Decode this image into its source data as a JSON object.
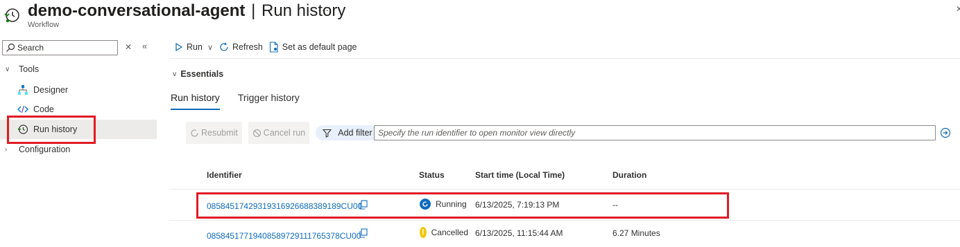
{
  "header": {
    "resource_name": "demo-conversational-agent",
    "separator": "|",
    "page_name": "Run history",
    "subtitle": "Workflow",
    "more_label": "···"
  },
  "sidebar": {
    "search": {
      "placeholder": "Search"
    },
    "items": [
      {
        "label": "Tools",
        "type": "group",
        "expanded": true
      },
      {
        "label": "Designer",
        "type": "child",
        "icon": "designer-icon"
      },
      {
        "label": "Code",
        "type": "child",
        "icon": "code-icon"
      },
      {
        "label": "Run history",
        "type": "child",
        "icon": "run-history-icon",
        "selected": true
      },
      {
        "label": "Configuration",
        "type": "group",
        "expanded": false
      }
    ]
  },
  "toolbar": {
    "run_label": "Run",
    "refresh_label": "Refresh",
    "set_default_label": "Set as default page"
  },
  "essentials": {
    "label": "Essentials"
  },
  "tabs": [
    {
      "label": "Run history",
      "active": true
    },
    {
      "label": "Trigger history",
      "active": false
    }
  ],
  "actions": {
    "resubmit_label": "Resubmit",
    "cancel_label": "Cancel run",
    "add_filter_label": "Add filter",
    "run_id_placeholder": "Specify the run identifier to open monitor view directly"
  },
  "table": {
    "columns": [
      "Identifier",
      "Status",
      "Start time (Local Time)",
      "Duration"
    ],
    "rows": [
      {
        "identifier": "08584517429319316926688389189CU00",
        "status": "Running",
        "status_color": "#0f6cbd",
        "start_time": "6/13/2025, 7:19:13 PM",
        "duration": "--"
      },
      {
        "identifier": "08584517719408589729111765378CU00",
        "status": "Cancelled",
        "status_color": "#f2c811",
        "start_time": "6/13/2025, 11:15:44 AM",
        "duration": "6.27 Minutes"
      }
    ]
  },
  "colors": {
    "accent": "#0f6cbd",
    "highlight": "#e01b24"
  }
}
